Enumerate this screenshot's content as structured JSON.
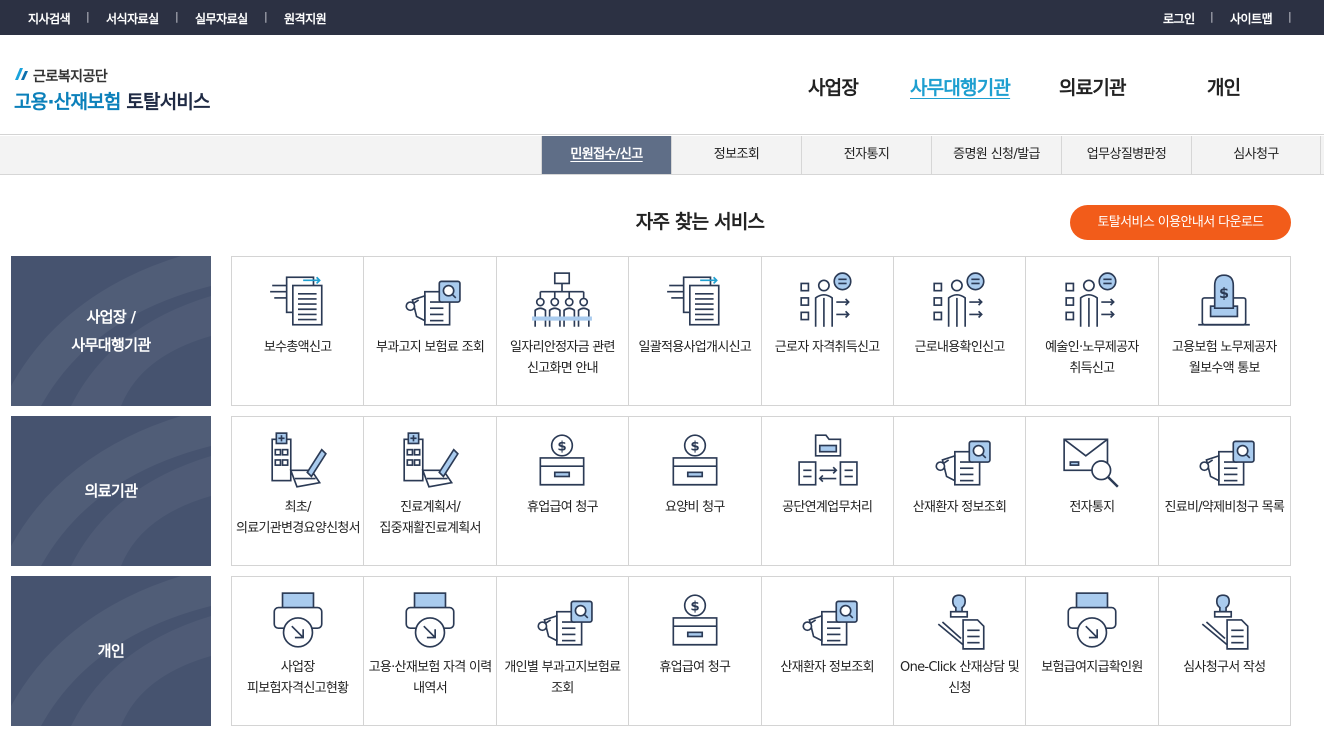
{
  "topbar": {
    "left_links": [
      "지사검색",
      "서식자료실",
      "실무자료실",
      "원격지원"
    ],
    "right_links": [
      "로그인",
      "사이트맵"
    ],
    "separator": "|"
  },
  "logo": {
    "org": "근로복지공단",
    "main_blue": "고용·산재보험",
    "main_dark": "토탈서비스"
  },
  "gnb": {
    "items": [
      "사업장",
      "사무대행기관",
      "의료기관",
      "개인"
    ],
    "active": "사무대행기관"
  },
  "subnav": {
    "tabs": [
      "민원접수/신고",
      "정보조회",
      "전자통지",
      "증명원 신청/발급",
      "업무상질병판정",
      "심사청구"
    ],
    "active": "민원접수/신고"
  },
  "section": {
    "title": "자주 찾는 서비스",
    "guide_button": "토탈서비스 이용안내서 다운로드"
  },
  "colors": {
    "topbar_bg": "#2c3143",
    "accent_blue": "#1e9fd0",
    "orange": "#f25c1a",
    "category_bg": "#46536f",
    "subnav_active": "#5f6e87"
  },
  "rows": [
    {
      "category": "사업장 /\n사무대행기관",
      "items": [
        {
          "label": "보수총액신고",
          "icon": "document-arrows-icon"
        },
        {
          "label": "부과고지 보험료 조회",
          "icon": "document-search-icon"
        },
        {
          "label": "일자리안정자금 관련 신고화면 안내",
          "icon": "org-chart-people-icon"
        },
        {
          "label": "일괄적용사업개시신고",
          "icon": "document-arrows-icon"
        },
        {
          "label": "근로자 자격취득신고",
          "icon": "person-checklist-icon"
        },
        {
          "label": "근로내용확인신고",
          "icon": "person-checklist-icon"
        },
        {
          "label": "예술인·노무제공자 취득신고",
          "icon": "person-checklist-icon"
        },
        {
          "label": "고용보험 노무제공자 월보수액 통보",
          "icon": "money-bag-monitor-icon"
        }
      ]
    },
    {
      "category": "의료기관",
      "items": [
        {
          "label": "최초/의료기관변경요양신청서",
          "icon": "hospital-pen-icon"
        },
        {
          "label": "진료계획서/집중재활진료계획서",
          "icon": "hospital-pen-icon"
        },
        {
          "label": "휴업급여 청구",
          "icon": "coin-box-icon"
        },
        {
          "label": "요양비 청구",
          "icon": "coin-box-icon"
        },
        {
          "label": "공단연계업무처리",
          "icon": "folder-exchange-icon"
        },
        {
          "label": "산재환자 정보조회",
          "icon": "document-search-icon"
        },
        {
          "label": "전자통지",
          "icon": "envelope-search-icon"
        },
        {
          "label": "진료비/약제비청구 목록",
          "icon": "document-search-icon"
        }
      ]
    },
    {
      "category": "개인",
      "items": [
        {
          "label": "사업장 피보험자격신고현황",
          "icon": "printer-download-icon"
        },
        {
          "label": "고용·산재보험 자격 이력 내역서",
          "icon": "printer-download-icon"
        },
        {
          "label": "개인별 부과고지보험료 조회",
          "icon": "document-search-icon"
        },
        {
          "label": "휴업급여 청구",
          "icon": "coin-box-icon"
        },
        {
          "label": "산재환자 정보조회",
          "icon": "document-search-icon"
        },
        {
          "label": "One-Click 산재상담 및 신청",
          "icon": "stamp-document-icon"
        },
        {
          "label": "보험급여지급확인원",
          "icon": "printer-download-icon"
        },
        {
          "label": "심사청구서 작성",
          "icon": "stamp-document-icon"
        }
      ]
    }
  ]
}
